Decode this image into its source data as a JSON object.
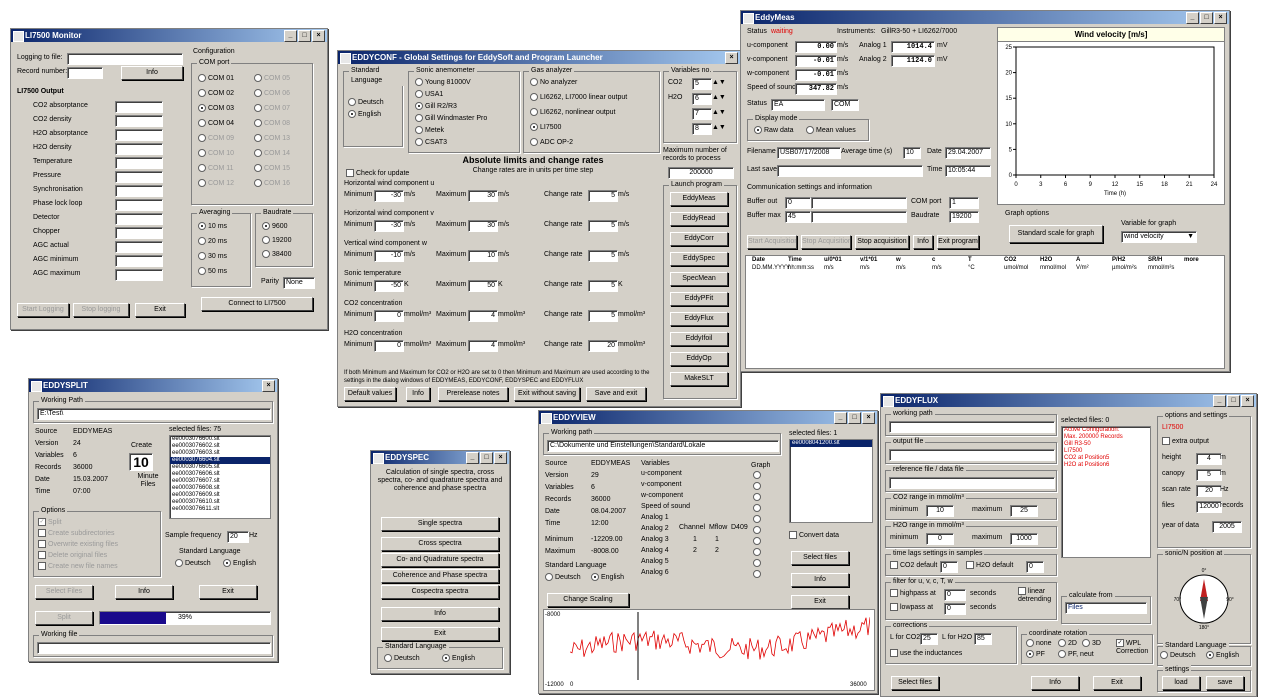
{
  "colors": {
    "titlebar": "#0a246a",
    "face": "#d4d0c8",
    "red": "#e00000",
    "progress": "#1a0a8c"
  },
  "monitor": {
    "title": "LI7500 Monitor",
    "logging_label": "Logging to file:",
    "record_label": "Record number:",
    "info_btn": "Info",
    "output_heading": "LI7500 Output",
    "rows": [
      "CO2 absorptance",
      "CO2 density",
      "H2O absorptance",
      "H2O density",
      "Temperature",
      "Pressure",
      "Synchronisation",
      "Phase lock loop",
      "Detector",
      "Chopper",
      "AGC actual",
      "AGC minimum",
      "AGC maximum"
    ],
    "config_label": "Configuration",
    "comport_label": "COM port",
    "com": [
      {
        "l": "COM 01",
        "r": "COM 05"
      },
      {
        "l": "COM 02",
        "r": "COM 06"
      },
      {
        "l": "COM 03",
        "r": "COM 07"
      },
      {
        "l": "COM 04",
        "r": "COM 08"
      },
      {
        "l": "COM 09",
        "r": "COM 13"
      },
      {
        "l": "COM 10",
        "r": "COM 14"
      },
      {
        "l": "COM 11",
        "r": "COM 15"
      },
      {
        "l": "COM 12",
        "r": "COM 16"
      }
    ],
    "averaging_label": "Averaging",
    "averaging": [
      "10 ms",
      "20 ms",
      "30 ms",
      "50 ms"
    ],
    "baud_label": "Baudrate",
    "baud": [
      "9600",
      "19200",
      "38400"
    ],
    "parity_label": "Parity",
    "parity_value": "None",
    "start_btn": "Start Logging",
    "stop_btn": "Stop logging",
    "exit_btn": "Exit",
    "connect_btn": "Connect to LI7500"
  },
  "conf": {
    "title": "EDDYCONF - Global Settings for EddySoft and Program Launcher",
    "lang_label": "Standard Language",
    "lang": [
      "Deutsch",
      "English"
    ],
    "check_updates": "Check for update",
    "sonic_label": "Sonic anemometer",
    "sonic": [
      "Young 81000V",
      "USA1",
      "Gill R2/R3",
      "Gill Windmaster Pro",
      "Metek",
      "CSAT3"
    ],
    "gas_label": "Gas analyzer",
    "gas": [
      "No analyzer",
      "LI6262, LI7000 linear output",
      "LI6262, nonlinear output",
      "LI7500",
      "ADC OP-2"
    ],
    "vars_label": "Variables no.",
    "vars": [
      {
        "n": "CO2",
        "v": "5"
      },
      {
        "n": "H2O",
        "v": "6"
      },
      {
        "n": "",
        "v": "7"
      },
      {
        "n": "",
        "v": "8"
      }
    ],
    "maxrec_label": "Maximum number of records to process",
    "maxrec_value": "200000",
    "limits_title": "Absolute limits and change rates",
    "limits_sub": "Change rates are in units per time step",
    "min_lbl": "Minimum",
    "max_lbl": "Maximum",
    "cr_lbl": "Change rate",
    "limits": [
      {
        "name": "Horizontal wind component u",
        "min": "-30",
        "max": "30",
        "cr": "5",
        "unit": "m/s"
      },
      {
        "name": "Horizontal wind component v",
        "min": "-30",
        "max": "30",
        "cr": "5",
        "unit": "m/s"
      },
      {
        "name": "Vertical wind component w",
        "min": "-10",
        "max": "10",
        "cr": "5",
        "unit": "m/s"
      },
      {
        "name": "Sonic temperature",
        "min": "-50",
        "max": "50",
        "cr": "5",
        "unit": "K"
      },
      {
        "name": "CO2 concentration",
        "min": "0",
        "max": "4",
        "cr": "5",
        "unit": "mmol/m³"
      },
      {
        "name": "H2O concentration",
        "min": "0",
        "max": "4",
        "cr": "20",
        "unit": "mmol/m³"
      }
    ],
    "note": "If both Minimum and Maximum for CO2 or H2O are set to 0 then Minimum and Maximum are used according to the settings in the dialog windows of EDDYMEAS, EDDYCONF, EDDYSPEC and EDDYFLUX",
    "launch_label": "Launch program",
    "launch": [
      "EddyMeas",
      "EddyRead",
      "EddyCorr",
      "EddySpec",
      "SpecMean",
      "EddyPFit",
      "EddyFlux",
      "EddyIfoil",
      "EddyOp",
      "MakeSLT"
    ],
    "bottom": [
      "Default values",
      "Info",
      "Prerelease notes",
      "Exit without saving",
      "Save and exit"
    ]
  },
  "meas": {
    "title": "EddyMeas",
    "status_label": "Status",
    "status_value": "waiting",
    "instr_label": "Instruments:",
    "instr_value": "GillR3-50 + LI6262/7000",
    "components": [
      {
        "n": "u-component",
        "v": "0.00",
        "u": "m/s"
      },
      {
        "n": "v-component",
        "v": "-0.01",
        "u": "m/s"
      },
      {
        "n": "w-component",
        "v": "-0.01",
        "u": "m/s"
      },
      {
        "n": "Speed of sound",
        "v": "347.82",
        "u": "m/s"
      }
    ],
    "analogs": [
      {
        "n": "Analog 1",
        "v": "1014.4",
        "u": "mV"
      },
      {
        "n": "Analog 2",
        "v": "1124.0",
        "u": "mV"
      }
    ],
    "status2_label": "Status",
    "status2_a": "EA",
    "status2_b": "COM",
    "display_label": "Display mode",
    "display": [
      "Raw data",
      "Mean values"
    ],
    "filename_label": "Filename",
    "filename_value": "USB07/17/2008",
    "avg_label": "Average time (s)",
    "avg_value": "10",
    "date_label": "Date",
    "date_value": "29.04.2007",
    "lastsave_label": "Last save",
    "time_label": "Time",
    "time_value": "10:05:44",
    "comm_label": "Communication settings and information",
    "bufout_label": "Buffer out",
    "bufout_value": "0",
    "bufmax_label": "Buffer max",
    "bufmax_value": "45",
    "comport_label": "COM port",
    "comport_value": "1",
    "baud_label": "Baudrate",
    "baud_value": "19200",
    "graph_opt": "Graph options",
    "std_scale_btn": "Standard scale for graph",
    "var_label": "Variable for graph",
    "var_value": "wind velocity",
    "buttons": [
      "Start Acquisition",
      "Stop Acquisition",
      "Stop acquisition",
      "Info",
      "Exit program"
    ],
    "header": [
      "Date",
      "Time",
      "u/0*01",
      "v/1*01",
      "w",
      "c",
      "T",
      "CO2",
      "H2O",
      "A",
      "P/H2",
      "SR/H",
      "more"
    ],
    "header2": [
      "DD.MM.YYYY",
      "hh:mm:ss",
      "m/s",
      "m/s",
      "m/s",
      "m/s",
      "°C",
      "umol/mol",
      "mmol/mol",
      "V/m²",
      "µmol/m²s",
      "mmol/m²s",
      ""
    ],
    "chart_title": "Wind velocity [m/s]",
    "x_label": "Time (h)"
  },
  "chart_data": {
    "type": "line",
    "title": "Wind velocity [m/s]",
    "xlabel": "Time (h)",
    "ylabel": "",
    "x_ticks": [
      0,
      3,
      6,
      9,
      12,
      15,
      18,
      21,
      24
    ],
    "y_ticks": [
      0,
      5,
      10,
      15,
      20,
      25
    ],
    "xlim": [
      0,
      24
    ],
    "ylim": [
      0,
      25
    ],
    "series": []
  },
  "split": {
    "title": "EDDYSPLIT",
    "wp_label": "Working Path",
    "wp_value": "E:\\Test\\",
    "info": [
      {
        "k": "Source",
        "v": "EDDYMEAS"
      },
      {
        "k": "Version",
        "v": "24"
      },
      {
        "k": "Variables",
        "v": "6"
      },
      {
        "k": "Records",
        "v": "36000"
      },
      {
        "k": "Date",
        "v": "15.03.2007"
      },
      {
        "k": "Time",
        "v": "07:00"
      }
    ],
    "files_label": "selected files: 75",
    "files": [
      "ee0003076600.slt",
      "ee0003076602.slt",
      "ee0003076603.slt",
      "ee0003076604.slt",
      "ee0003076605.slt",
      "ee0003076606.slt",
      "ee0003076607.slt",
      "ee0003076608.slt",
      "ee0003076609.slt",
      "ee0003076610.slt",
      "ee0003076611.slt"
    ],
    "create_label": "Create",
    "spin_value": "10",
    "minute_label": "Minute Files",
    "options_label": "Options",
    "options": [
      "Split",
      "Create subdirectories",
      "Overwrite existing files",
      "Delete original files",
      "Create new file names"
    ],
    "sample_label": "Sample frequency",
    "sample_value": "20",
    "hz": "Hz",
    "lang_label": "Standard Language",
    "lang": [
      "Deutsch",
      "English"
    ],
    "btns": [
      "Select Files",
      "Info",
      "Exit",
      "Split"
    ],
    "progress_value": "39%",
    "progress": 0.39,
    "working_file_label": "Working file"
  },
  "spec": {
    "title": "EDDYSPEC",
    "desc": "Calculation of single spectra, cross spectra, co- and quadrature spectra and coherence and phase spectra",
    "btns": [
      "Single spectra",
      "Cross spectra",
      "Co- and Quadrature spectra",
      "Coherence and Phase spectra",
      "Cospectra spectra",
      "Info",
      "Exit"
    ],
    "lang_label": "Standard Language",
    "lang": [
      "Deutsch",
      "English"
    ]
  },
  "view": {
    "title": "EDDYVIEW",
    "wp_label": "Working path",
    "wp_value": "C:\\Dokumente und Einstellungen\\Standard\\Lokale",
    "info": [
      {
        "k": "Source",
        "v": "EDDYMEAS"
      },
      {
        "k": "Version",
        "v": "29"
      },
      {
        "k": "Variables",
        "v": "6"
      },
      {
        "k": "Records",
        "v": "36000"
      },
      {
        "k": "Date",
        "v": "08.04.2007"
      },
      {
        "k": "Time",
        "v": "12:00"
      },
      {
        "k": "Minimum",
        "v": "-12209.00"
      },
      {
        "k": "Maximum",
        "v": "-8008.00"
      }
    ],
    "vars_label": "Variables",
    "vars": [
      "u-component",
      "v-component",
      "w-component",
      "Speed of sound",
      "Analog 1",
      "Analog 2",
      "Analog 3",
      "Analog 4",
      "Analog 5",
      "Analog 6"
    ],
    "graph_label": "Graph",
    "chan_label": "Channel",
    "mflow_label": "Mflow",
    "d409_label": "D409",
    "analog_vals": [
      {
        "c": "1",
        "m": "1"
      },
      {
        "c": "2",
        "m": "2"
      }
    ],
    "files_label": "selected files: 1",
    "files": [
      "ee0008041200.slt"
    ],
    "convert_label": "Convert data",
    "btns": [
      "Select files",
      "Info",
      "Exit"
    ],
    "lang_label": "Standard Language",
    "lang": [
      "Deutsch",
      "English"
    ],
    "scale_btn": "Change Scaling",
    "y_top": "-8000",
    "y_bot": "-12000",
    "x_left": "0",
    "x_right": "36000"
  },
  "flux": {
    "title": "EDDYFLUX",
    "wp_label": "working path",
    "of_label": "output file",
    "ref_label": "reference file / data file",
    "co2_label": "CO2 range in mmol/m³",
    "min_lbl": "minimum",
    "max_lbl": "maximum",
    "co2_min": "10",
    "co2_max": "25",
    "h2o_label": "H2O range in mmol/m³",
    "h2o_min": "0",
    "h2o_max": "1000",
    "timelag_label": "time lags settings in samples",
    "co2_default": "CO2 default",
    "co2_def_v": "0",
    "h2o_default": "H2O default",
    "h2o_def_v": "0",
    "filter_label": "filter for u, v, c, T, w",
    "filter": [
      {
        "n": "highpass at",
        "v": "0",
        "u": "seconds"
      },
      {
        "n": "lowpass at",
        "v": "0",
        "u": "seconds"
      }
    ],
    "detrend": "linear detrending",
    "corr_label": "corrections",
    "lco2_label": "L for CO2",
    "lco2": "25",
    "lh2o_label": "L for H2O",
    "lh2o": "85",
    "inductance": "use the inductances",
    "coord_label": "coordinate rotation",
    "coord": [
      "none",
      "2D",
      "3D",
      "PF",
      "PF, neut"
    ],
    "wpl": "WPL Correction",
    "files_label": "selected files: 0",
    "logs": [
      "Active Configuration:",
      "",
      "Max. 200000 Records",
      "Gill R3-50",
      "LI7500",
      "CO2 at Position5",
      "H2O at Position6"
    ],
    "calc_label": "calculate from",
    "calc_value": "Files",
    "opts_label": "options and settings",
    "opts_device": "LI7500",
    "extra_output": "extra output",
    "height_label": "height",
    "height": "4",
    "canopy_label": "canopy",
    "canopy": "5",
    "m": "m",
    "scan_label": "scan rate",
    "scan": "20",
    "hz": "Hz",
    "files_n_label": "files",
    "files_n": "12000",
    "records": "records",
    "year_label": "year of data",
    "year": "2005",
    "sonic_label": "sonic/N position at",
    "compass": [
      "0°",
      "90°",
      "180°",
      "270°"
    ],
    "lang_label": "Standard Language",
    "lang": [
      "Deutsch",
      "English"
    ],
    "settings_label": "settings",
    "settings_btns": [
      "load",
      "save"
    ],
    "btns": [
      "Select files",
      "Info",
      "Exit"
    ]
  }
}
